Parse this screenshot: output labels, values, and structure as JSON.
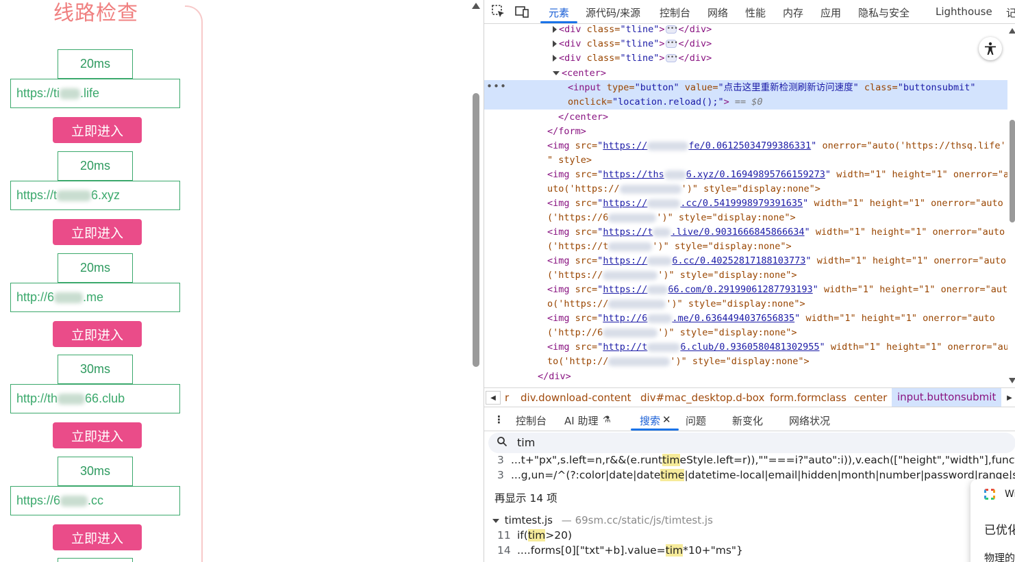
{
  "page": {
    "title": "线路检查",
    "lines": [
      {
        "ms": "20ms",
        "url_prefix": "https://ti",
        "url_suffix": ".life",
        "button": "立即进入"
      },
      {
        "ms": "20ms",
        "url_prefix": "https://t",
        "url_suffix": "6.xyz",
        "button": "立即进入"
      },
      {
        "ms": "20ms",
        "url_prefix": "http://6",
        "url_suffix": ".me",
        "button": "立即进入"
      },
      {
        "ms": "30ms",
        "url_prefix": "http://th",
        "url_suffix": "66.club",
        "button": "立即进入"
      },
      {
        "ms": "30ms",
        "url_prefix": "https://6",
        "url_suffix": ".cc",
        "button": "立即进入"
      }
    ]
  },
  "devtools": {
    "tabs": [
      "元素",
      "源代码/来源",
      "控制台",
      "网络",
      "性能",
      "内存",
      "应用",
      "隐私与安全",
      "Lighthouse",
      "记"
    ],
    "active_tab": "元素",
    "dom": {
      "tline_tag": "<div",
      "tline_attr": "class=",
      "tline_val": "\"tline\"",
      "tline_close": "</div>",
      "center_open": "<center>",
      "input_open": "<input",
      "type_attr": "type=",
      "type_val": "\"button\"",
      "value_attr": "value=",
      "value_val": "\"点击这里重新检测刷新访问速度\"",
      "class_attr": "class=",
      "class_val": "\"buttonsubmit\"",
      "onclick_attr": "onclick=",
      "onclick_val": "\"location.reload();\"",
      "eq0": "== $0",
      "center_close": "</center>",
      "form_close": "</form>",
      "div_close": "</div>",
      "imgs": [
        {
          "src_a": "https://",
          "src_b": "fe/0.06125034799386331",
          "rest": "onerror=\"auto('https://thsq.life')",
          "rest2": "\" style>"
        },
        {
          "src_a": "https://ths",
          "src_b": "6.xyz/0.16949895766159273",
          "rest": "width=\"1\" height=\"1\" onerror=\"a",
          "rest2": "uto('https://",
          "rest3": "')\" style=\"display:none\">"
        },
        {
          "src_a": "https://",
          "src_b": ".cc/0.5419998979391635",
          "rest": "width=\"1\" height=\"1\" onerror=\"auto",
          "rest2": "('https://6",
          "rest3": "')\" style=\"display:none\">"
        },
        {
          "src_a": "https://t",
          "src_b": ".live/0.9031666845866634",
          "rest": "width=\"1\" height=\"1\" onerror=\"auto",
          "rest2": "('https://t",
          "rest3": "')\" style=\"display:none\">"
        },
        {
          "src_a": "https://",
          "src_b": "6.cc/0.40252817188103773",
          "rest": "width=\"1\" height=\"1\" onerror=\"auto",
          "rest2": "('https://",
          "rest3": "')\" style=\"display:none\">"
        },
        {
          "src_a": "https://",
          "src_b": "66.com/0.29199061287793193",
          "rest": "width=\"1\" height=\"1\" onerror=\"aut",
          "rest2": "o('https://",
          "rest3": "')\" style=\"display:none\">"
        },
        {
          "src_a": "http://6",
          "src_b": ".me/0.6364494037656835",
          "rest": "width=\"1\" height=\"1\" onerror=\"auto",
          "rest2": "('http://6",
          "rest3": "')\" style=\"display:none\">"
        },
        {
          "src_a": "http://t",
          "src_b": "6.club/0.9360580481302955",
          "rest": "width=\"1\" height=\"1\" onerror=\"au",
          "rest2": "to('http://",
          "rest3": "')\" style=\"display:none\">"
        }
      ]
    },
    "breadcrumb": [
      "r",
      "div.download-content",
      "div#mac_desktop.d-box",
      "form.formclass",
      "center",
      "input.buttonsubmit"
    ],
    "drawer_tabs": [
      "控制台",
      "AI 助理",
      "搜索",
      "问题",
      "新变化",
      "网络状况"
    ],
    "drawer_active": "搜索",
    "search_query": "tim",
    "results": [
      {
        "num": "3",
        "pre": "...t+\"px\",s.left=n,r&&(e.runt",
        "match": "tim",
        "post": "eStyle.left=r)),\"\"===i?\"auto\":i)),v.each([\"height\",\"width\"],function(e,t){v.cs"
      },
      {
        "num": "3",
        "pre": "...g,un=/^(?:color|date|date",
        "match": "time",
        "post": "|datetime-local|email|hidden|month|number|password|range|search|tel"
      }
    ],
    "show_more": "再显示 14 项",
    "file": {
      "name": "timtest.js",
      "sep": "—",
      "path": "69sm.cc/static/js/timtest.js"
    },
    "file_results": [
      {
        "num": "11",
        "pre": "if(",
        "match": "tim",
        "post": ">20)"
      },
      {
        "num": "14",
        "pre": "....forms[0][\"txt\"+b].value=",
        "match": "tim",
        "post": "*10+\"ms\"}"
      }
    ],
    "popup": {
      "t1": "Wi",
      "t2": "已优化",
      "t3": "物理的"
    }
  }
}
